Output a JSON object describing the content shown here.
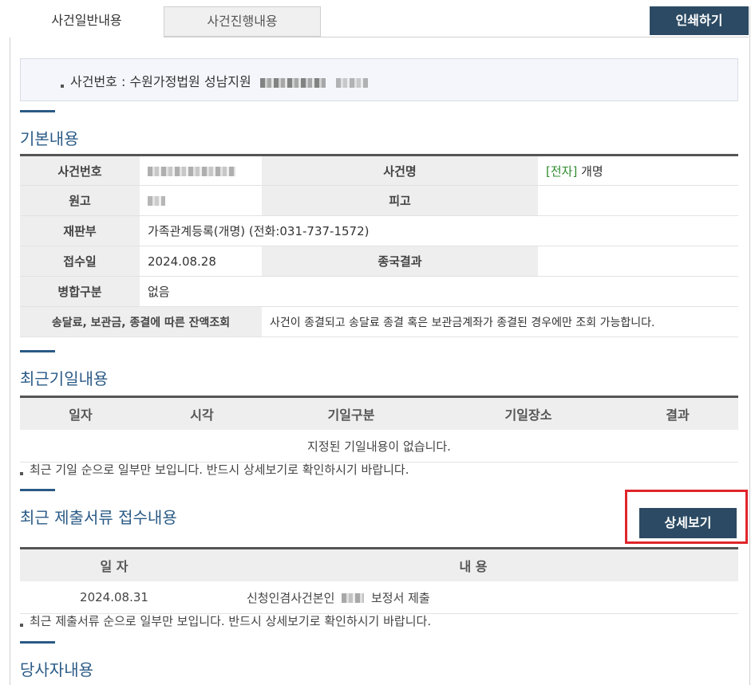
{
  "tabs": [
    {
      "label": "사건일반내용"
    },
    {
      "label": "사건진행내용"
    }
  ],
  "print_button": "인쇄하기",
  "case_header": "사건번호 : 수원가정법원 성남지원",
  "basic": {
    "title": "기본내용",
    "rows": {
      "case_no_label": "사건번호",
      "case_name_label": "사건명",
      "case_name_prefix": "[전자]",
      "case_name_value": "개명",
      "plaintiff_label": "원고",
      "defendant_label": "피고",
      "court_label": "재판부",
      "court_value": "가족관계등록(개명) (전화:031-737-1572)",
      "received_label": "접수일",
      "received_value": "2024.08.28",
      "final_result_label": "종국결과",
      "merge_label": "병합구분",
      "merge_value": "없음",
      "balance_label": "송달료, 보관금, 종결에 따른 잔액조회",
      "balance_value": "사건이 종결되고 송달료 종결 혹은 보관금계좌가 종결된 경우에만 조회 가능합니다."
    }
  },
  "recent_dates": {
    "title": "최근기일내용",
    "headers": [
      "일자",
      "시각",
      "기일구분",
      "기일장소",
      "결과"
    ],
    "empty": "지정된 기일내용이 없습니다.",
    "note": "최근 기일 순으로 일부만 보입니다. 반드시 상세보기로 확인하시기 바랍니다."
  },
  "recent_docs": {
    "title": "최근 제출서류 접수내용",
    "detail_button": "상세보기",
    "headers": [
      "일 자",
      "내 용"
    ],
    "rows": [
      {
        "date": "2024.08.31",
        "content_prefix": "신청인겸사건본인",
        "content_suffix": "보정서 제출"
      }
    ],
    "note": "최근 제출서류 순으로 일부만 보입니다. 반드시 상세보기로 확인하시기 바랍니다."
  },
  "parties": {
    "title": "당사자내용"
  }
}
